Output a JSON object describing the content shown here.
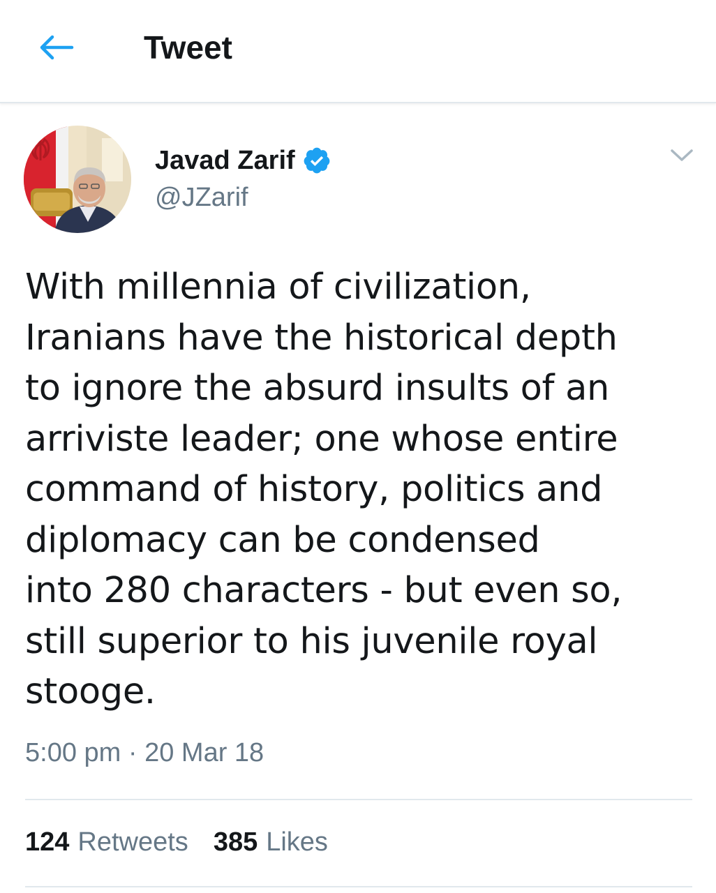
{
  "header": {
    "title": "Tweet",
    "back_icon": "arrow-left-icon"
  },
  "author": {
    "display_name": "Javad Zarif",
    "handle": "@JZarif",
    "verified": true,
    "verified_icon": "verified-badge-icon"
  },
  "tweet": {
    "text": "With millennia of civilization,\nIranians have the historical depth\nto ignore the absurd insults of an\narriviste leader; one whose entire\ncommand of history, politics and\ndiplomacy can be condensed\ninto 280 characters - but even so,\nstill superior to his juvenile royal\nstooge.",
    "time": "5:00 pm",
    "separator": "·",
    "date": "20 Mar 18"
  },
  "stats": {
    "retweets_count": "124",
    "retweets_label": "Retweets",
    "likes_count": "385",
    "likes_label": "Likes"
  },
  "colors": {
    "accent": "#1da1f2",
    "text_primary": "#14171a",
    "text_secondary": "#657786",
    "divider": "#e1e8ed"
  }
}
